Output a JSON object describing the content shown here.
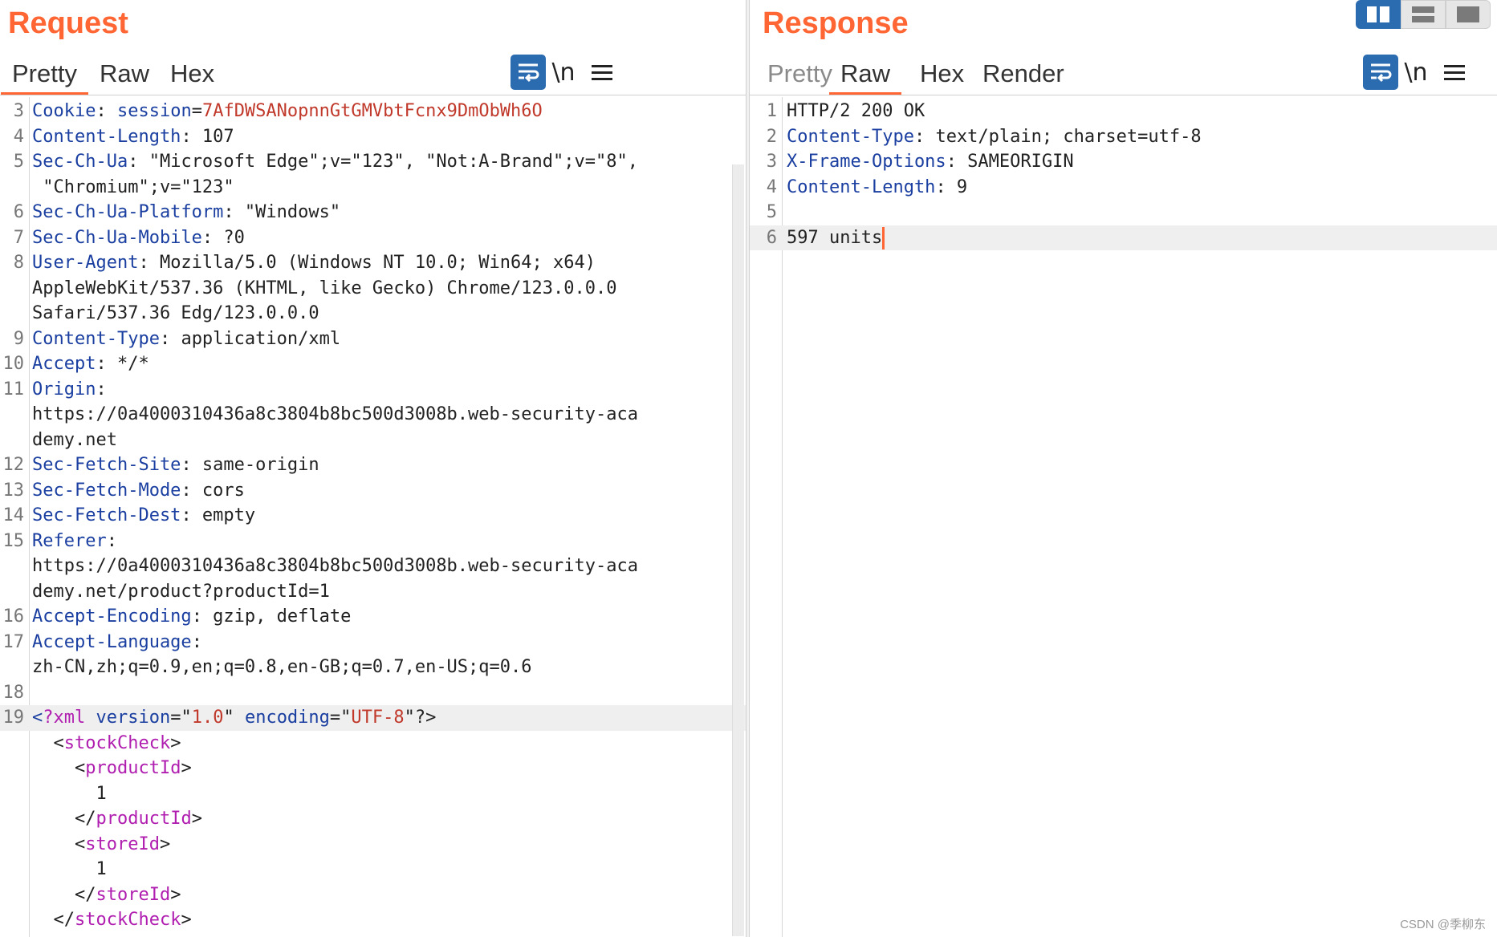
{
  "request": {
    "title": "Request",
    "tabs": [
      "Pretty",
      "Raw",
      "Hex"
    ],
    "active_tab": "Pretty",
    "newline_label": "\\n",
    "lines": [
      {
        "n": "3",
        "segs": [
          [
            "k",
            "Cookie"
          ],
          [
            "v",
            ": "
          ],
          [
            "k",
            "session"
          ],
          [
            "v",
            "="
          ],
          [
            "s",
            "7AfDWSANopnnGtGMVbtFcnx9DmObWh6O"
          ]
        ]
      },
      {
        "n": "4",
        "segs": [
          [
            "k",
            "Content-Length"
          ],
          [
            "v",
            ": 107"
          ]
        ]
      },
      {
        "n": "5",
        "segs": [
          [
            "k",
            "Sec-Ch-Ua"
          ],
          [
            "v",
            ": \"Microsoft Edge\";v=\"123\", \"Not:A-Brand\";v=\"8\","
          ]
        ]
      },
      {
        "n": "",
        "segs": [
          [
            "v",
            " \"Chromium\";v=\"123\""
          ]
        ]
      },
      {
        "n": "6",
        "segs": [
          [
            "k",
            "Sec-Ch-Ua-Platform"
          ],
          [
            "v",
            ": \"Windows\""
          ]
        ]
      },
      {
        "n": "7",
        "segs": [
          [
            "k",
            "Sec-Ch-Ua-Mobile"
          ],
          [
            "v",
            ": ?0"
          ]
        ]
      },
      {
        "n": "8",
        "segs": [
          [
            "k",
            "User-Agent"
          ],
          [
            "v",
            ": Mozilla/5.0 (Windows NT 10.0; Win64; x64)"
          ]
        ]
      },
      {
        "n": "",
        "segs": [
          [
            "v",
            "AppleWebKit/537.36 (KHTML, like Gecko) Chrome/123.0.0.0"
          ]
        ]
      },
      {
        "n": "",
        "segs": [
          [
            "v",
            "Safari/537.36 Edg/123.0.0.0"
          ]
        ]
      },
      {
        "n": "9",
        "segs": [
          [
            "k",
            "Content-Type"
          ],
          [
            "v",
            ": application/xml"
          ]
        ]
      },
      {
        "n": "10",
        "segs": [
          [
            "k",
            "Accept"
          ],
          [
            "v",
            ": */*"
          ]
        ]
      },
      {
        "n": "11",
        "segs": [
          [
            "k",
            "Origin"
          ],
          [
            "v",
            ":"
          ]
        ]
      },
      {
        "n": "",
        "segs": [
          [
            "v",
            "https://0a4000310436a8c3804b8bc500d3008b.web-security-aca"
          ]
        ]
      },
      {
        "n": "",
        "segs": [
          [
            "v",
            "demy.net"
          ]
        ]
      },
      {
        "n": "12",
        "segs": [
          [
            "k",
            "Sec-Fetch-Site"
          ],
          [
            "v",
            ": same-origin"
          ]
        ]
      },
      {
        "n": "13",
        "segs": [
          [
            "k",
            "Sec-Fetch-Mode"
          ],
          [
            "v",
            ": cors"
          ]
        ]
      },
      {
        "n": "14",
        "segs": [
          [
            "k",
            "Sec-Fetch-Dest"
          ],
          [
            "v",
            ": empty"
          ]
        ]
      },
      {
        "n": "15",
        "segs": [
          [
            "k",
            "Referer"
          ],
          [
            "v",
            ":"
          ]
        ]
      },
      {
        "n": "",
        "segs": [
          [
            "v",
            "https://0a4000310436a8c3804b8bc500d3008b.web-security-aca"
          ]
        ]
      },
      {
        "n": "",
        "segs": [
          [
            "v",
            "demy.net/product?productId=1"
          ]
        ]
      },
      {
        "n": "16",
        "segs": [
          [
            "k",
            "Accept-Encoding"
          ],
          [
            "v",
            ": gzip, deflate"
          ]
        ]
      },
      {
        "n": "17",
        "segs": [
          [
            "k",
            "Accept-Language"
          ],
          [
            "v",
            ":"
          ]
        ]
      },
      {
        "n": "",
        "segs": [
          [
            "v",
            "zh-CN,zh;q=0.9,en;q=0.8,en-GB;q=0.7,en-US;q=0.6"
          ]
        ]
      },
      {
        "n": "18",
        "segs": []
      },
      {
        "n": "19",
        "hl": true,
        "segs": [
          [
            "k",
            "<"
          ],
          [
            "t",
            "?xml"
          ],
          [
            "v",
            " "
          ],
          [
            "k",
            "version"
          ],
          [
            "v",
            "=\""
          ],
          [
            "s",
            "1.0"
          ],
          [
            "v",
            "\" "
          ],
          [
            "k",
            "encoding"
          ],
          [
            "v",
            "=\""
          ],
          [
            "s",
            "UTF-8"
          ],
          [
            "v",
            "\"?>"
          ]
        ]
      },
      {
        "n": "",
        "segs": [
          [
            "v",
            "  <"
          ],
          [
            "t",
            "stockCheck"
          ],
          [
            "v",
            ">"
          ]
        ]
      },
      {
        "n": "",
        "segs": [
          [
            "v",
            "    <"
          ],
          [
            "t",
            "productId"
          ],
          [
            "v",
            ">"
          ]
        ]
      },
      {
        "n": "",
        "segs": [
          [
            "v",
            "      1"
          ]
        ]
      },
      {
        "n": "",
        "segs": [
          [
            "v",
            "    </"
          ],
          [
            "t",
            "productId"
          ],
          [
            "v",
            ">"
          ]
        ]
      },
      {
        "n": "",
        "segs": [
          [
            "v",
            "    <"
          ],
          [
            "t",
            "storeId"
          ],
          [
            "v",
            ">"
          ]
        ]
      },
      {
        "n": "",
        "segs": [
          [
            "v",
            "      1"
          ]
        ]
      },
      {
        "n": "",
        "segs": [
          [
            "v",
            "    </"
          ],
          [
            "t",
            "storeId"
          ],
          [
            "v",
            ">"
          ]
        ]
      },
      {
        "n": "",
        "segs": [
          [
            "v",
            "  </"
          ],
          [
            "t",
            "stockCheck"
          ],
          [
            "v",
            ">"
          ]
        ]
      }
    ]
  },
  "response": {
    "title": "Response",
    "tabs": [
      "Pretty",
      "Raw",
      "Hex",
      "Render"
    ],
    "active_tab": "Raw",
    "newline_label": "\\n",
    "lines": [
      {
        "n": "1",
        "segs": [
          [
            "v",
            "HTTP/2 200 OK"
          ]
        ]
      },
      {
        "n": "2",
        "segs": [
          [
            "k",
            "Content-Type"
          ],
          [
            "v",
            ": text/plain; charset=utf-8"
          ]
        ]
      },
      {
        "n": "3",
        "segs": [
          [
            "k",
            "X-Frame-Options"
          ],
          [
            "v",
            ": SAMEORIGIN"
          ]
        ]
      },
      {
        "n": "4",
        "segs": [
          [
            "k",
            "Content-Length"
          ],
          [
            "v",
            ": 9"
          ]
        ]
      },
      {
        "n": "5",
        "segs": []
      },
      {
        "n": "6",
        "hl": true,
        "caret": true,
        "segs": [
          [
            "v",
            "597 units"
          ]
        ]
      }
    ]
  },
  "colors": {
    "accent": "#ff6633",
    "button_blue": "#2b6bb0",
    "header_key": "#1a3fa0",
    "string": "#c0392b",
    "xml_tag": "#b01eb0"
  },
  "watermark": "CSDN @季柳东"
}
